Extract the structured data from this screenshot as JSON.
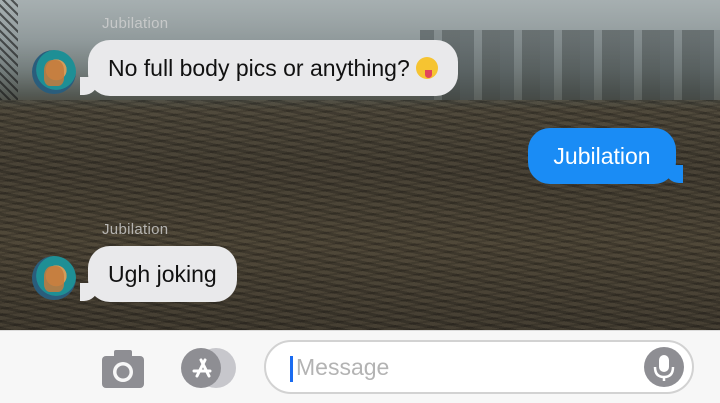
{
  "conversation": {
    "messages": [
      {
        "sender": "Jubilation",
        "direction": "incoming",
        "text": "No full body pics or anything?",
        "emoji": "winking-face-with-tongue"
      },
      {
        "direction": "outgoing",
        "text": "Jubilation"
      },
      {
        "sender": "Jubilation",
        "direction": "incoming",
        "text": "Ugh joking"
      }
    ]
  },
  "input_bar": {
    "placeholder": "Message",
    "camera_icon": "camera-icon",
    "apps_icon": "app-store-icon",
    "mic_icon": "microphone-icon"
  },
  "colors": {
    "outgoing_bubble": "#1a8cf5",
    "incoming_bubble": "#e9e9eb",
    "caret": "#1a6bf0"
  }
}
